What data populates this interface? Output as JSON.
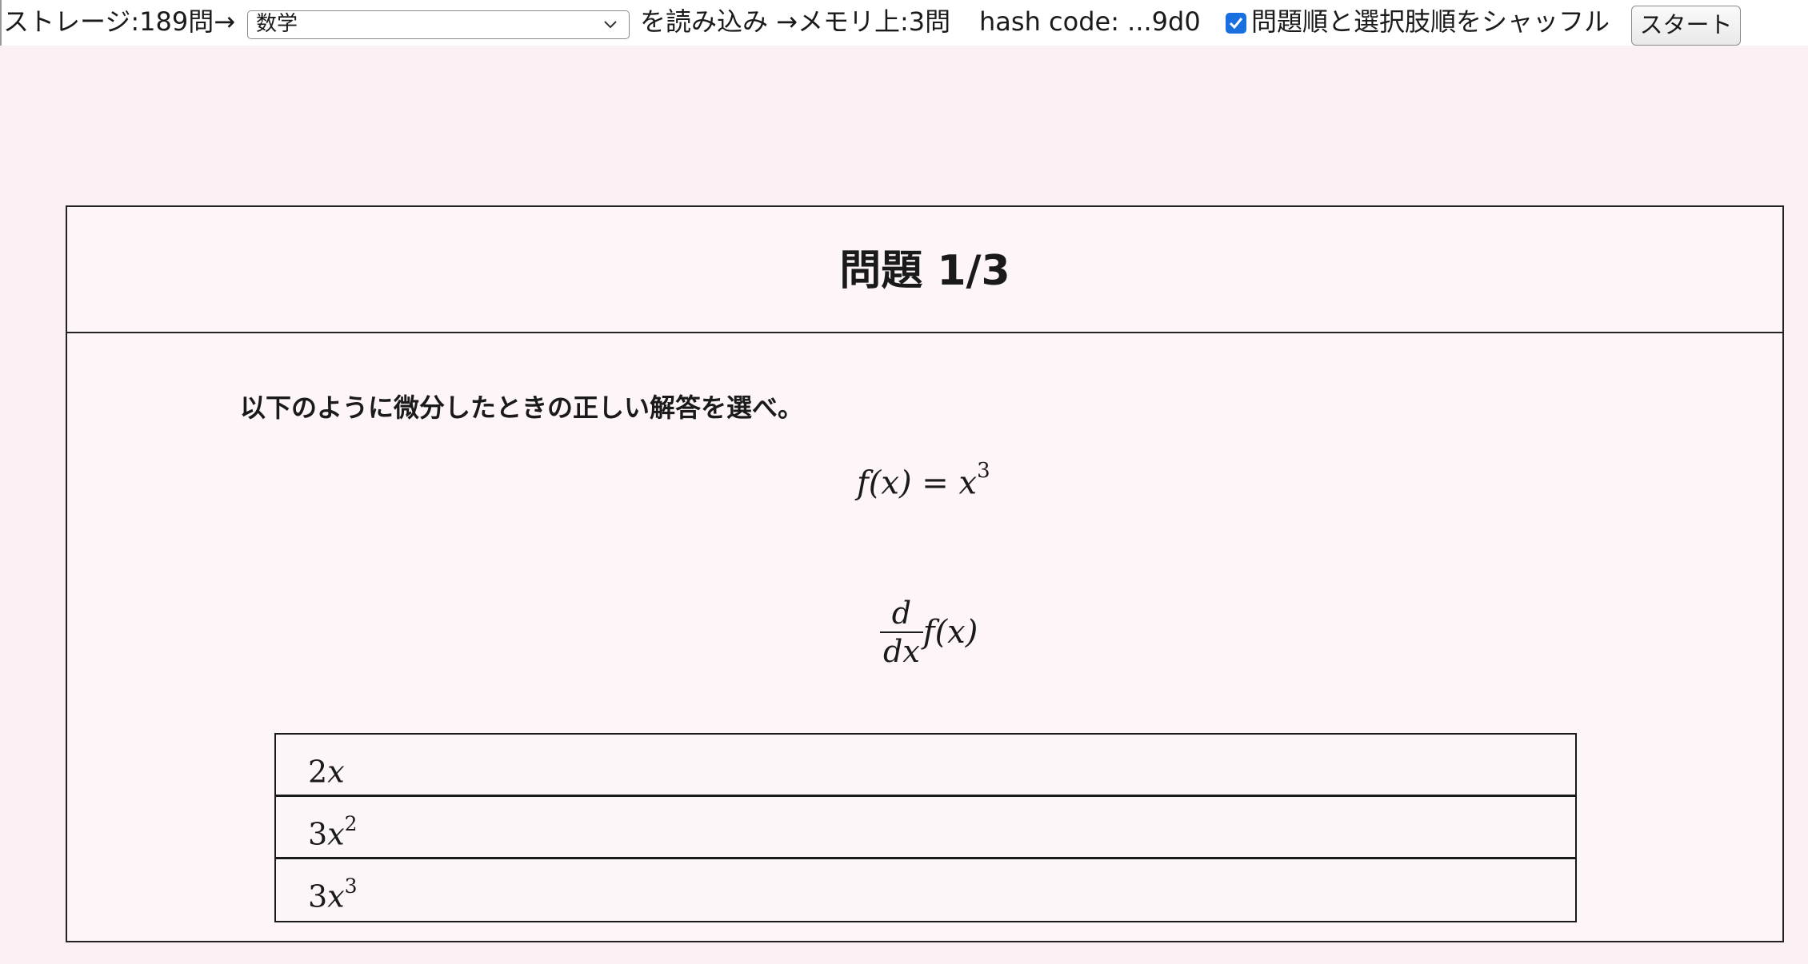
{
  "toolbar": {
    "storage_label": "ストレージ:189問→",
    "select_value": "数学",
    "load_label": "を読み込み →メモリ上:3問",
    "hash_label": "hash code: ...9d0",
    "shuffle_checked": true,
    "shuffle_label": "問題順と選択肢順をシャッフル",
    "start_label": "スタート"
  },
  "card": {
    "title": "問題 1/3",
    "instruction": "以下のように微分したときの正しい解答を選べ。",
    "equation": {
      "function": "f(x) = x",
      "exponent": "3"
    },
    "derivative": {
      "numerator": "d",
      "denominator": "dx",
      "applied_to": "f(x)"
    },
    "choices": [
      {
        "coefficient": "2",
        "variable": "x",
        "exponent": ""
      },
      {
        "coefficient": "3",
        "variable": "x",
        "exponent": "2"
      },
      {
        "coefficient": "3",
        "variable": "x",
        "exponent": "3"
      }
    ]
  },
  "colors": {
    "page_background": "#fbf0f4",
    "checkbox_accent": "#1a6fe0"
  }
}
